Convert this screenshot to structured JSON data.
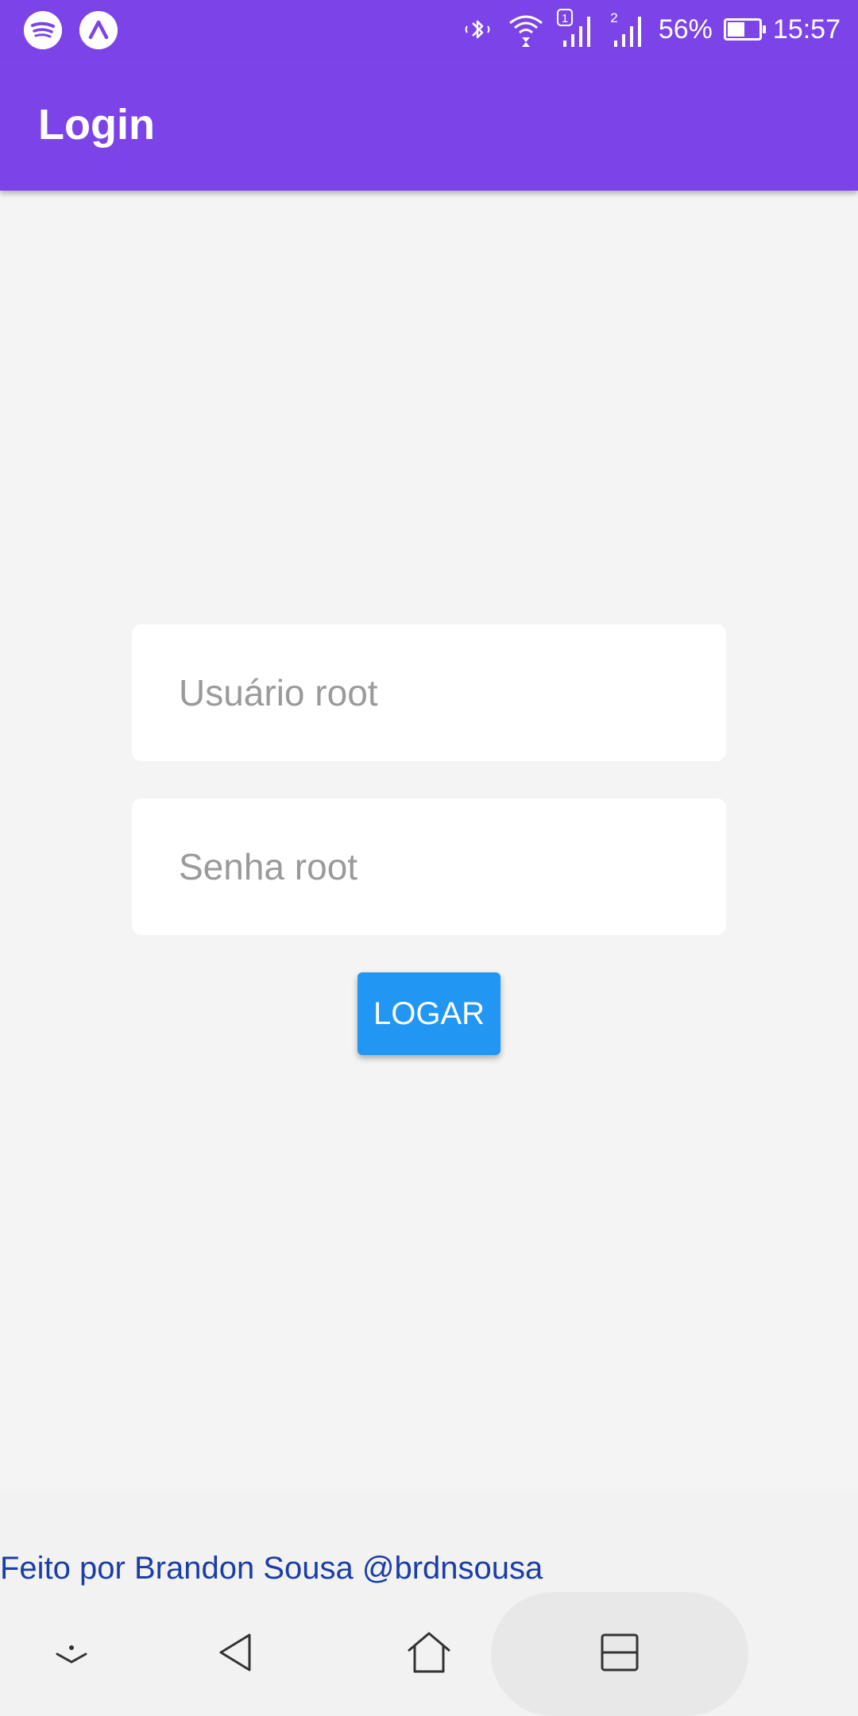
{
  "status_bar": {
    "apps": [
      "spotify-icon",
      "expo-icon"
    ],
    "icons": [
      "bluetooth-icon",
      "wifi-icon",
      "sim1-signal-icon",
      "sim2-signal-icon"
    ],
    "battery_percent": "56%",
    "battery_level": 0.56,
    "time": "15:57"
  },
  "appbar": {
    "title": "Login"
  },
  "form": {
    "username_placeholder": "Usuário root",
    "username_value": "",
    "password_placeholder": "Senha root",
    "password_value": "",
    "submit_label": "LOGAR"
  },
  "footer": {
    "credit": "Feito por Brandon Sousa @brdnsousa"
  },
  "navbar": {
    "buttons": [
      "chevron-down-icon",
      "back-icon",
      "home-icon",
      "recents-icon"
    ]
  },
  "colors": {
    "primary": "#7c44e8",
    "button": "#2196f3",
    "link": "#1a3ea8"
  }
}
